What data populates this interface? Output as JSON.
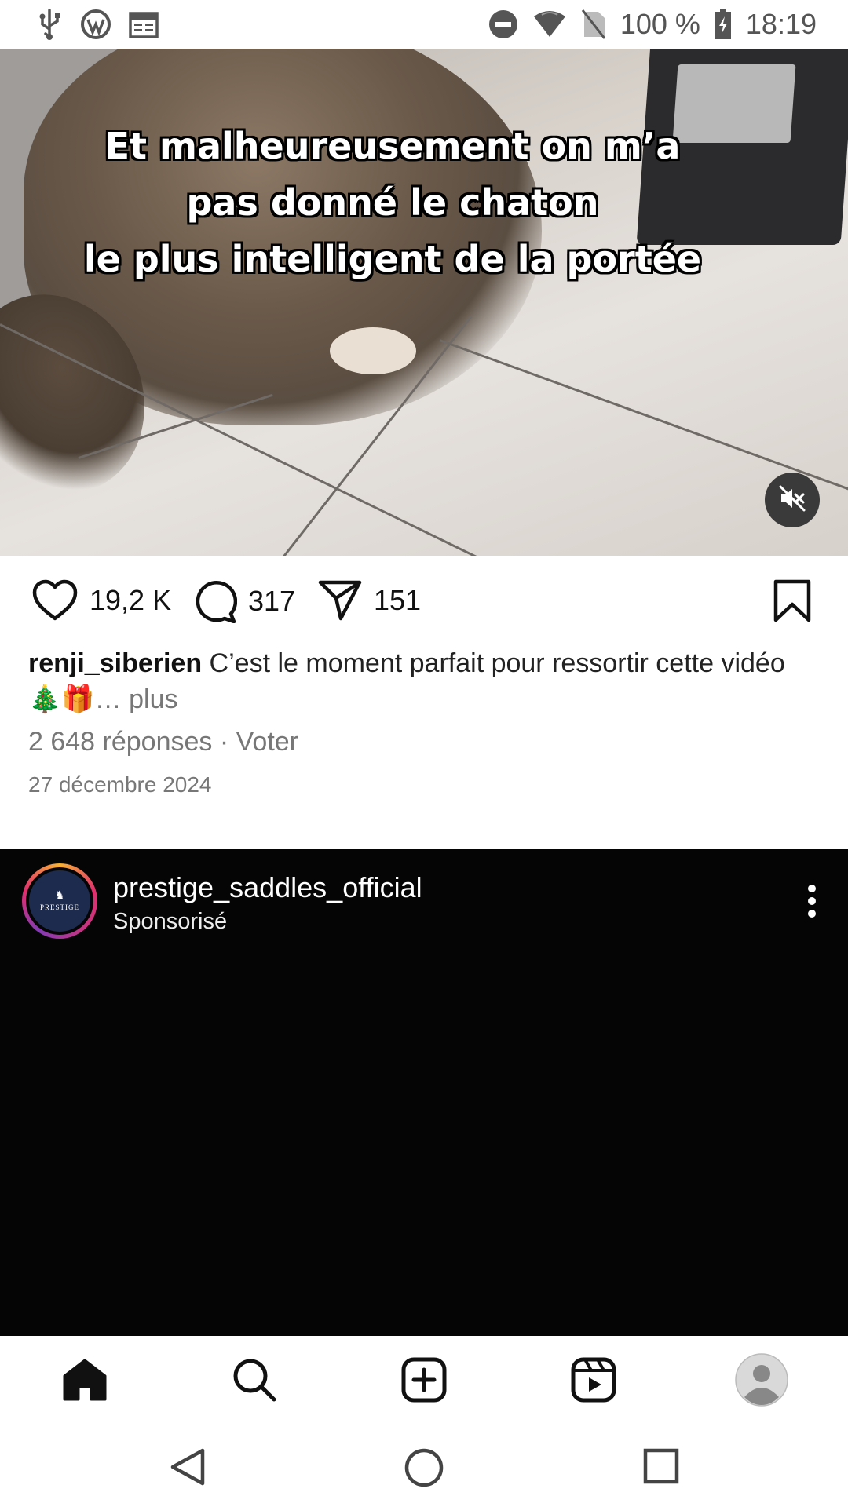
{
  "status_bar": {
    "battery": "100 %",
    "time": "18:19",
    "icons": [
      "usb-icon",
      "wordpress-icon",
      "calendar-icon",
      "do-not-disturb-icon",
      "wifi-icon",
      "no-sim-icon",
      "battery-charging-icon"
    ]
  },
  "video": {
    "caption_lines": [
      "Et malheureusement on m’a",
      "pas donné le chaton",
      "le plus intelligent de la portée"
    ],
    "muted": true
  },
  "actions": {
    "likes": "19,2 K",
    "comments": "317",
    "shares": "151"
  },
  "post": {
    "username": "renji_siberien",
    "text": " C’est le moment parfait pour ressortir cette vidéo",
    "emojis": "🎄🎁",
    "more": "… plus",
    "replies": "2 648 réponses · Voter",
    "date": "27 décembre 2024"
  },
  "sponsored_post": {
    "account": "prestige_saddles_official",
    "label": "Sponsorisé",
    "logo_text": "PRESTIGE"
  },
  "bottom_nav": {
    "items": [
      "home-icon",
      "search-icon",
      "create-icon",
      "reels-icon",
      "profile-avatar"
    ]
  }
}
